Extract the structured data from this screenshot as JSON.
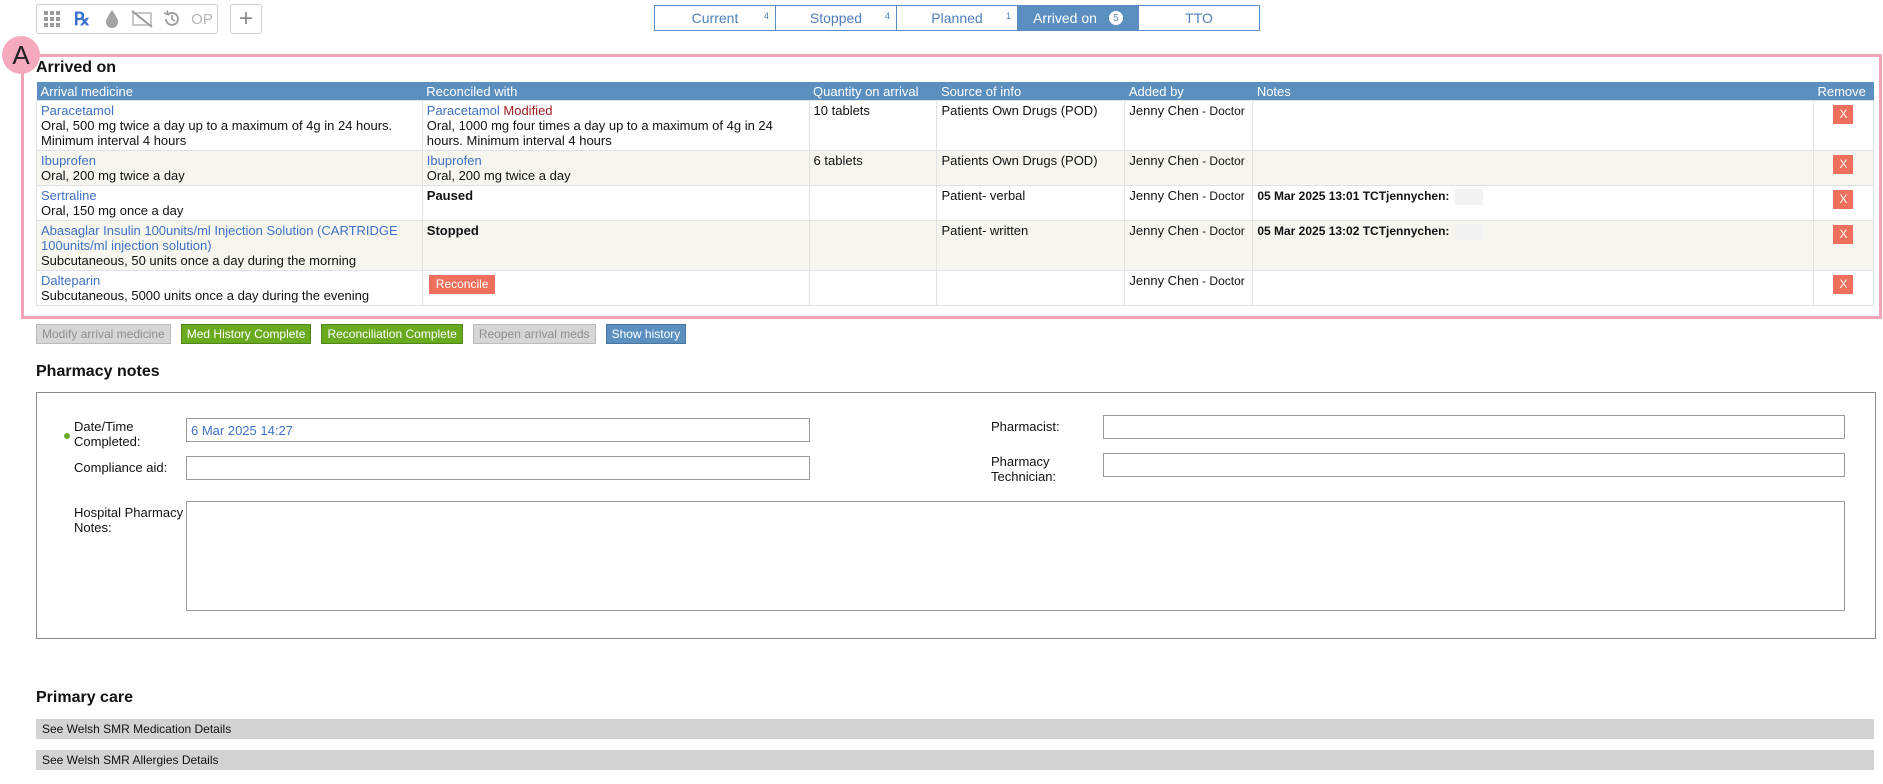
{
  "toolbar": {
    "icons": [
      "grid-icon",
      "rx-icon",
      "drop-icon",
      "no-image-icon",
      "history-icon",
      "op-icon"
    ],
    "rx_label": "℞",
    "op_label": "OP",
    "add_label": "+"
  },
  "tabs": [
    {
      "label": "Current",
      "count": "4"
    },
    {
      "label": "Stopped",
      "count": "4"
    },
    {
      "label": "Planned",
      "count": "1"
    },
    {
      "label": "Arrived on",
      "count": "5"
    },
    {
      "label": "TTO",
      "count": ""
    }
  ],
  "annotation": {
    "letter": "A"
  },
  "arrived": {
    "title": "Arrived on",
    "headers": {
      "medicine": "Arrival medicine",
      "reconciled": "Reconciled with",
      "quantity": "Quantity on arrival",
      "source": "Source of info",
      "added": "Added by",
      "notes": "Notes",
      "remove": "Remove"
    },
    "rows": [
      {
        "name": "Paracetamol",
        "dose": "Oral, 500 mg twice a day up to a maximum of 4g in 24 hours. Minimum interval 4 hours",
        "rec_name": "Paracetamol",
        "rec_status": "Modified",
        "rec_dose": "Oral, 1000 mg four times a day up to a maximum of 4g in 24 hours. Minimum interval 4 hours",
        "quantity": "10 tablets",
        "source": "Patients Own Drugs (POD)",
        "added_by": "Jenny Chen",
        "role": " - Doctor",
        "notes": "",
        "remove": "X"
      },
      {
        "name": "Ibuprofen",
        "dose": "Oral, 200 mg twice a day",
        "rec_name": "Ibuprofen",
        "rec_status": "",
        "rec_dose": "Oral, 200 mg twice a day",
        "quantity": "6 tablets",
        "source": "Patients Own Drugs (POD)",
        "added_by": "Jenny Chen",
        "role": " - Doctor",
        "notes": "",
        "remove": "X"
      },
      {
        "name": "Sertraline",
        "dose": "Oral, 150 mg once a day",
        "rec_status_bold": "Paused",
        "quantity": "",
        "source": "Patient- verbal",
        "added_by": "Jenny Chen",
        "role": " - Doctor",
        "notes": "05 Mar 2025 13:01 TCTjennychen:",
        "remove": "X"
      },
      {
        "name": "Abasaglar Insulin 100units/ml Injection Solution (CARTRIDGE 100units/ml injection solution)",
        "dose": "Subcutaneous, 50 units once a day during the morning",
        "rec_status_bold": "Stopped",
        "quantity": "",
        "source": "Patient- written",
        "added_by": "Jenny Chen",
        "role": " - Doctor",
        "notes": "05 Mar 2025 13:02 TCTjennychen:",
        "remove": "X"
      },
      {
        "name": "Dalteparin",
        "dose": "Subcutaneous, 5000 units once a day during the evening",
        "reconcile_label": "Reconcile",
        "quantity": "",
        "source": "",
        "added_by": "Jenny Chen",
        "role": " - Doctor",
        "notes": "",
        "remove": "X"
      }
    ]
  },
  "actions": {
    "modify": "Modify arrival medicine",
    "med_history": "Med History Complete",
    "reconciliation": "Reconciliation Complete",
    "reopen": "Reopen arrival meds",
    "show_history": "Show history"
  },
  "pharmacy": {
    "title": "Pharmacy notes",
    "datetime_label": "Date/Time Completed:",
    "datetime_value": "6 Mar 2025 14:27",
    "compliance_label": "Compliance aid:",
    "compliance_value": "",
    "pharmacist_label": "Pharmacist:",
    "pharmacist_value": "",
    "technician_label": "Pharmacy Technician:",
    "technician_value": "",
    "hospital_notes_label": "Hospital Pharmacy Notes:",
    "hospital_notes_value": ""
  },
  "primary_care": {
    "title": "Primary care",
    "medication_link": "See Welsh SMR Medication Details",
    "allergies_link": "See Welsh SMR Allergies Details"
  },
  "colors": {
    "accent_blue": "#5b8fc0",
    "link_blue": "#3f71c4",
    "remove_red": "#ef6f5d",
    "complete_green": "#6aaa1f",
    "annotation_pink": "#f0a5b6"
  }
}
